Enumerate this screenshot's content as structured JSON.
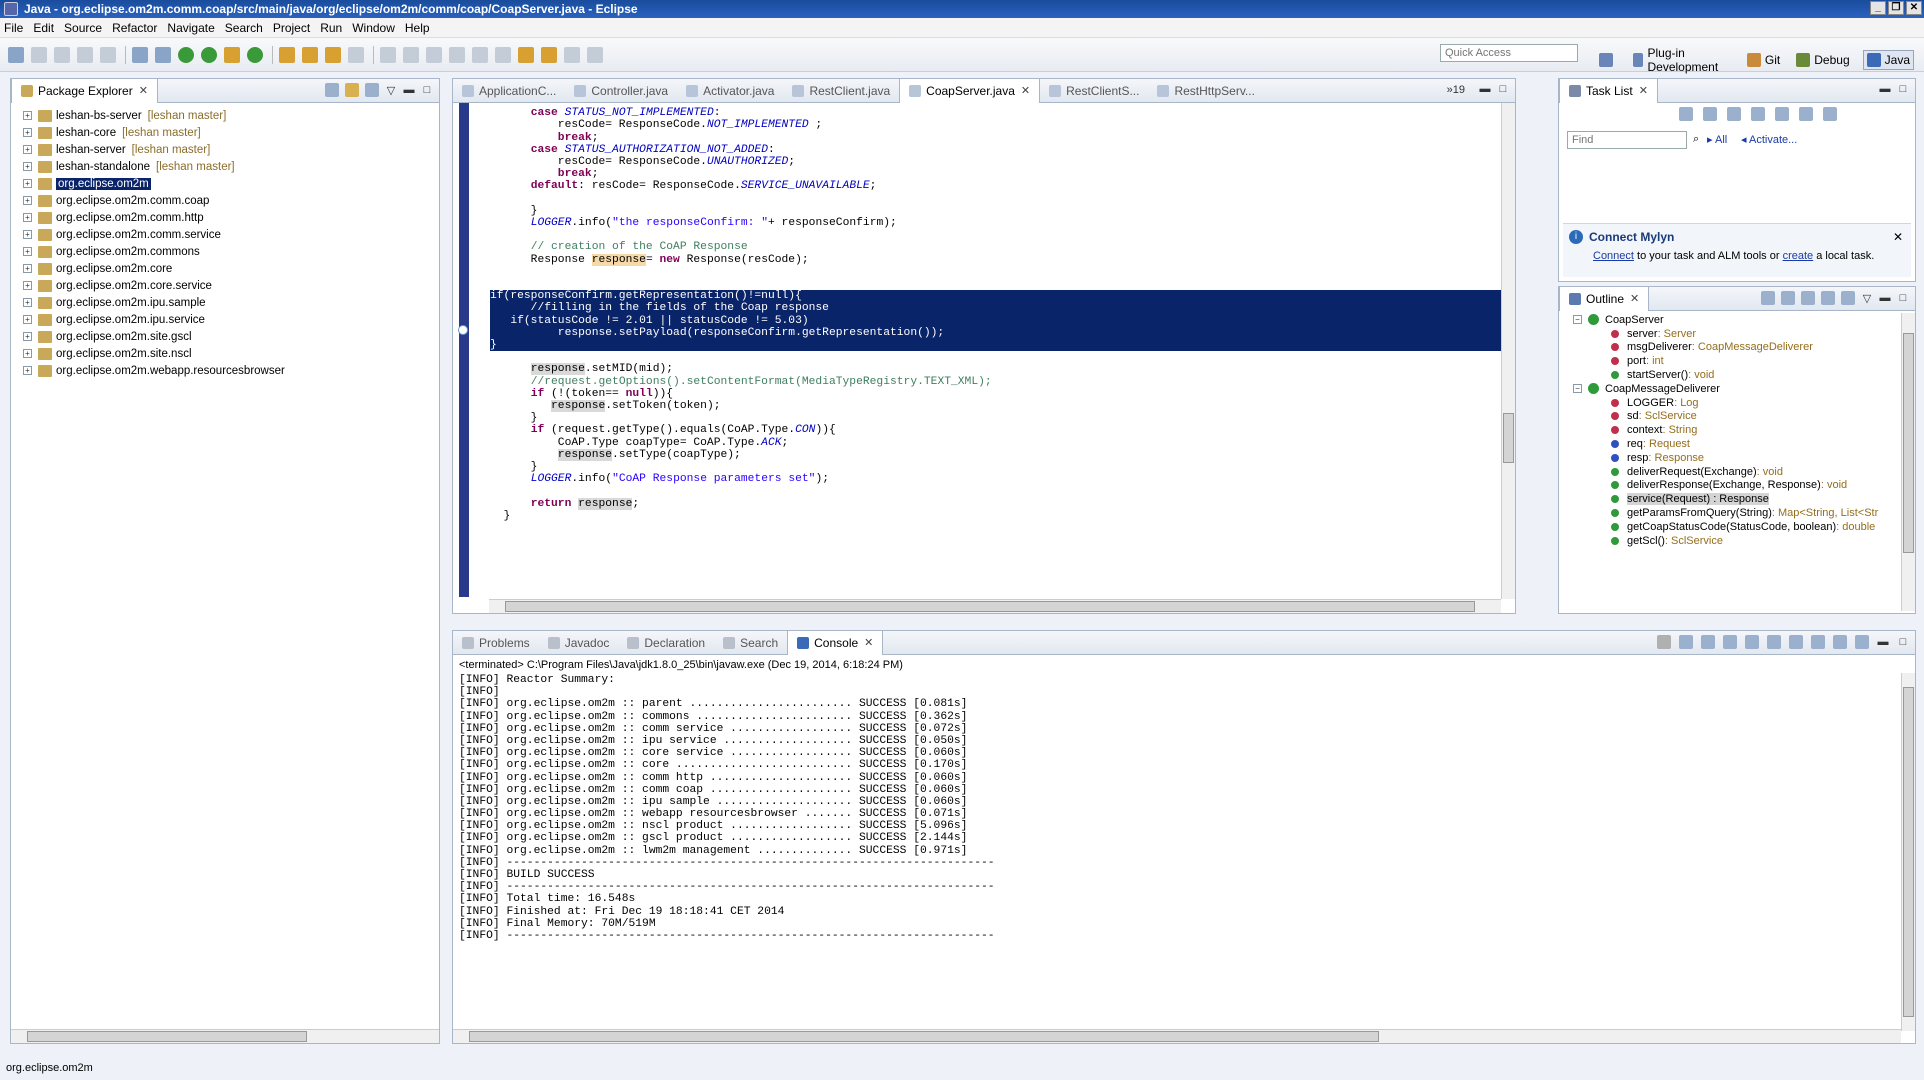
{
  "window": {
    "title": "Java - org.eclipse.om2m.comm.coap/src/main/java/org/eclipse/om2m/comm/coap/CoapServer.java - Eclipse",
    "minimize": "_",
    "restore": "❐",
    "close": "✕"
  },
  "menu": [
    "File",
    "Edit",
    "Source",
    "Refactor",
    "Navigate",
    "Search",
    "Project",
    "Run",
    "Window",
    "Help"
  ],
  "toolbar": {
    "quick_access_placeholder": "Quick Access",
    "perspectives": [
      "Plug-in Development",
      "Git",
      "Debug",
      "Java"
    ]
  },
  "package_explorer": {
    "tab": "Package Explorer",
    "items": [
      {
        "name": "leshan-bs-server",
        "repo": "[leshan master]"
      },
      {
        "name": "leshan-core",
        "repo": "[leshan master]"
      },
      {
        "name": "leshan-server",
        "repo": "[leshan master]"
      },
      {
        "name": "leshan-standalone",
        "repo": "[leshan master]"
      },
      {
        "name": "org.eclipse.om2m",
        "repo": ""
      },
      {
        "name": "org.eclipse.om2m.comm.coap",
        "repo": ""
      },
      {
        "name": "org.eclipse.om2m.comm.http",
        "repo": ""
      },
      {
        "name": "org.eclipse.om2m.comm.service",
        "repo": ""
      },
      {
        "name": "org.eclipse.om2m.commons",
        "repo": ""
      },
      {
        "name": "org.eclipse.om2m.core",
        "repo": ""
      },
      {
        "name": "org.eclipse.om2m.core.service",
        "repo": ""
      },
      {
        "name": "org.eclipse.om2m.ipu.sample",
        "repo": ""
      },
      {
        "name": "org.eclipse.om2m.ipu.service",
        "repo": ""
      },
      {
        "name": "org.eclipse.om2m.site.gscl",
        "repo": ""
      },
      {
        "name": "org.eclipse.om2m.site.nscl",
        "repo": ""
      },
      {
        "name": "org.eclipse.om2m.webapp.resourcesbrowser",
        "repo": ""
      }
    ]
  },
  "editor": {
    "tabs": [
      "ApplicationC...",
      "Controller.java",
      "Activator.java",
      "RestClient.java",
      "CoapServer.java",
      "RestClientS...",
      "RestHttpServ..."
    ],
    "overflow": "»19"
  },
  "task_list": {
    "tab": "Task List",
    "find_placeholder": "Find",
    "all": "All",
    "activate": "Activate...",
    "mylyn_title": "Connect Mylyn",
    "mylyn_connect": "Connect",
    "mylyn_mid": " to your task and ALM tools or ",
    "mylyn_create": "create",
    "mylyn_end": " a local task."
  },
  "outline": {
    "tab": "Outline",
    "classes": [
      {
        "name": "CoapServer",
        "members": [
          {
            "name": "server",
            "type": " : Server",
            "color": "#c0304a"
          },
          {
            "name": "msgDeliverer",
            "type": " : CoapMessageDeliverer",
            "color": "#c0304a"
          },
          {
            "name": "port",
            "type": " : int",
            "color": "#c0304a"
          },
          {
            "name": "startServer()",
            "type": " : void",
            "color": "#2e9a3a"
          }
        ]
      },
      {
        "name": "CoapMessageDeliverer",
        "members": [
          {
            "name": "LOGGER",
            "type": " : Log",
            "color": "#c0304a"
          },
          {
            "name": "sd",
            "type": " : SclService",
            "color": "#c0304a"
          },
          {
            "name": "context",
            "type": " : String",
            "color": "#c0304a"
          },
          {
            "name": "req",
            "type": " : Request",
            "color": "#3050c0"
          },
          {
            "name": "resp",
            "type": " : Response",
            "color": "#3050c0"
          },
          {
            "name": "deliverRequest(Exchange)",
            "type": " : void",
            "color": "#2e9a3a"
          },
          {
            "name": "deliverResponse(Exchange, Response)",
            "type": " : void",
            "color": "#2e9a3a"
          },
          {
            "name": "service(Request) : Response",
            "type": "",
            "color": "#2e9a3a"
          },
          {
            "name": "getParamsFromQuery(String)",
            "type": " : Map<String, List<Str",
            "color": "#2e9a3a"
          },
          {
            "name": "getCoapStatusCode(StatusCode, boolean)",
            "type": " : double",
            "color": "#2e9a3a"
          },
          {
            "name": "getScl()",
            "type": " : SclService",
            "color": "#2e9a3a"
          }
        ]
      }
    ]
  },
  "bottom_tabs": [
    "Problems",
    "Javadoc",
    "Declaration",
    "Search",
    "Console"
  ],
  "console": {
    "header": "<terminated> C:\\Program Files\\Java\\jdk1.8.0_25\\bin\\javaw.exe (Dec 19, 2014, 6:18:24 PM)",
    "lines": [
      "[INFO] Reactor Summary:",
      "[INFO]",
      "[INFO] org.eclipse.om2m :: parent ........................ SUCCESS [0.081s]",
      "[INFO] org.eclipse.om2m :: commons ....................... SUCCESS [0.362s]",
      "[INFO] org.eclipse.om2m :: comm service .................. SUCCESS [0.072s]",
      "[INFO] org.eclipse.om2m :: ipu service ................... SUCCESS [0.050s]",
      "[INFO] org.eclipse.om2m :: core service .................. SUCCESS [0.060s]",
      "[INFO] org.eclipse.om2m :: core .......................... SUCCESS [0.170s]",
      "[INFO] org.eclipse.om2m :: comm http ..................... SUCCESS [0.060s]",
      "[INFO] org.eclipse.om2m :: comm coap ..................... SUCCESS [0.060s]",
      "[INFO] org.eclipse.om2m :: ipu sample .................... SUCCESS [0.060s]",
      "[INFO] org.eclipse.om2m :: webapp resourcesbrowser ....... SUCCESS [0.071s]",
      "[INFO] org.eclipse.om2m :: nscl product .................. SUCCESS [5.096s]",
      "[INFO] org.eclipse.om2m :: gscl product .................. SUCCESS [2.144s]",
      "[INFO] org.eclipse.om2m :: lwm2m management .............. SUCCESS [0.971s]",
      "[INFO] ------------------------------------------------------------------------",
      "[INFO] BUILD SUCCESS",
      "[INFO] ------------------------------------------------------------------------",
      "[INFO] Total time: 16.548s",
      "[INFO] Finished at: Fri Dec 19 18:18:41 CET 2014",
      "[INFO] Final Memory: 70M/519M",
      "[INFO] ------------------------------------------------------------------------"
    ]
  },
  "status_bar": {
    "text": "org.eclipse.om2m"
  }
}
